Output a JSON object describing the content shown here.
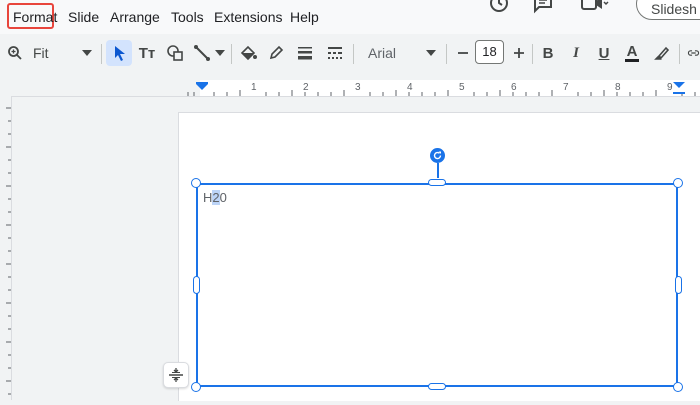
{
  "menu": {
    "items": [
      "Format",
      "Slide",
      "Arrange",
      "Tools",
      "Extensions",
      "Help"
    ],
    "highlighted": "Format"
  },
  "header": {
    "slideshow_label": "Slidesh",
    "icons": [
      "history-icon",
      "comment-icon",
      "meet-icon"
    ]
  },
  "toolbar": {
    "zoom_label": "Fit",
    "font_name": "Arial",
    "font_size": "18",
    "text_tool_label": "Tт",
    "bold_label": "B",
    "italic_label": "I",
    "underline_label": "U",
    "text_color_label": "A",
    "accent_color": "#1a73e8"
  },
  "ruler": {
    "numbers": [
      "1",
      "2",
      "3",
      "4",
      "5",
      "6",
      "7",
      "8",
      "9"
    ]
  },
  "textbox": {
    "text_before": "H",
    "text_selected": "2",
    "text_after": "0"
  }
}
